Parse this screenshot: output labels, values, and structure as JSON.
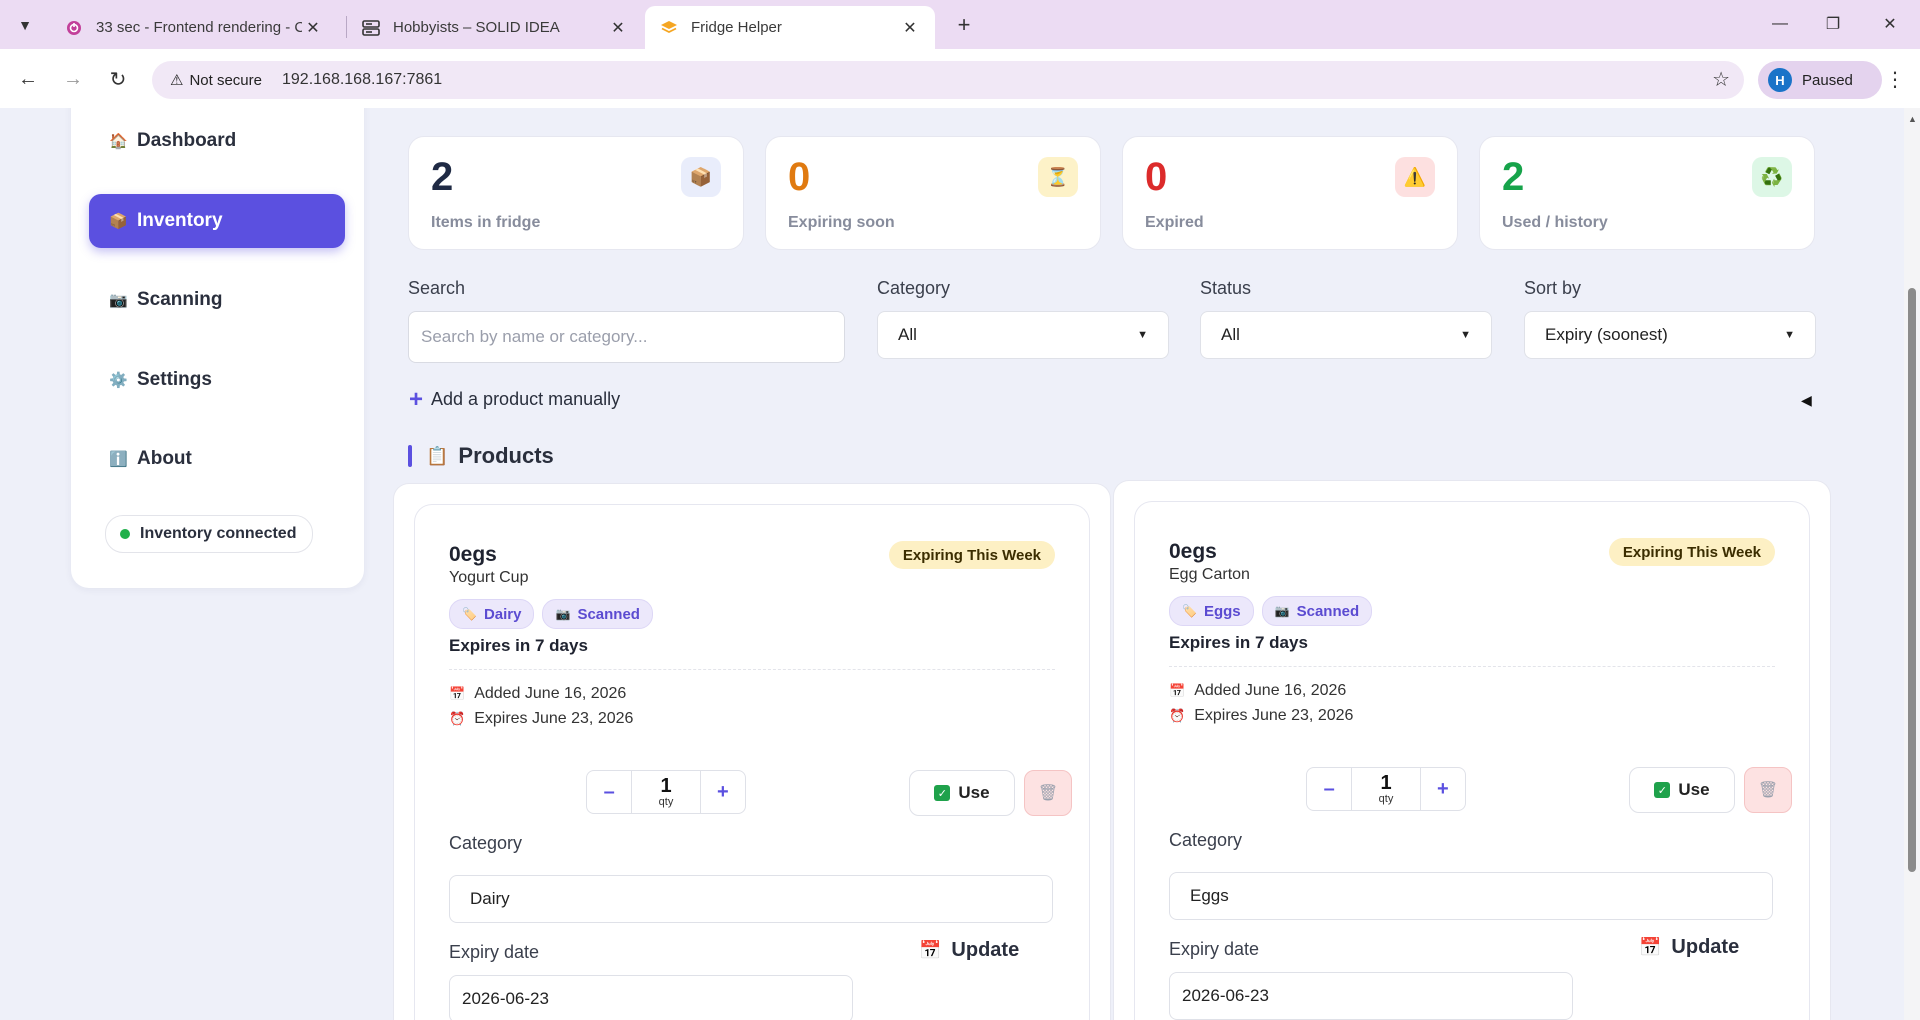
{
  "browser": {
    "tabs": [
      {
        "title": "33 sec - Frontend rendering - C",
        "icon": "timer-icon"
      },
      {
        "title": "Hobbyists – SOLID IDEA",
        "icon": "server-icon"
      },
      {
        "title": "Fridge Helper",
        "icon": "layers-icon"
      }
    ],
    "security_label": "Not secure",
    "url": "192.168.168.167:7861",
    "profile_initial": "H",
    "profile_status": "Paused"
  },
  "sidebar": {
    "items": [
      {
        "label": "Dashboard",
        "icon": "🏠"
      },
      {
        "label": "Inventory",
        "icon": "📦"
      },
      {
        "label": "Scanning",
        "icon": "📷"
      },
      {
        "label": "Settings",
        "icon": "⚙️"
      },
      {
        "label": "About",
        "icon": "ℹ️"
      }
    ],
    "status": "Inventory connected"
  },
  "stats": [
    {
      "value": "2",
      "label": "Items in fridge",
      "icon": "📦",
      "color": "#1f2a44",
      "badge_bg": "#e9edfb"
    },
    {
      "value": "0",
      "label": "Expiring soon",
      "icon": "⏳",
      "color": "#e07a10",
      "badge_bg": "#fdf2c8"
    },
    {
      "value": "0",
      "label": "Expired",
      "icon": "⚠️",
      "color": "#dc2b2b",
      "badge_bg": "#fde0e0"
    },
    {
      "value": "2",
      "label": "Used / history",
      "icon": "♻️",
      "color": "#16a34a",
      "badge_bg": "#ddf7e6"
    }
  ],
  "filters": {
    "search_label": "Search",
    "search_placeholder": "Search by name or category...",
    "category_label": "Category",
    "category_value": "All",
    "status_label": "Status",
    "status_value": "All",
    "sort_label": "Sort by",
    "sort_value": "Expiry (soonest)"
  },
  "add_manual": "Add a product manually",
  "products_title": "Products",
  "products_icon": "📋",
  "products": [
    {
      "name": "0egs",
      "subtitle": "Yogurt Cup",
      "status": "Expiring This Week",
      "tags": [
        {
          "label": "Dairy",
          "icon": "🏷️"
        },
        {
          "label": "Scanned",
          "icon": "📷"
        }
      ],
      "expires_text": "Expires in 7 days",
      "added": "Added June 16, 2026",
      "expires_on": "Expires June 23, 2026",
      "qty": "1",
      "qty_unit": "qty",
      "use_label": "Use",
      "category_label": "Category",
      "category_value": "Dairy",
      "expiry_label": "Expiry date",
      "expiry_value": "2026-06-23",
      "update_label": "Update"
    },
    {
      "name": "0egs",
      "subtitle": "Egg Carton",
      "status": "Expiring This Week",
      "tags": [
        {
          "label": "Eggs",
          "icon": "🏷️"
        },
        {
          "label": "Scanned",
          "icon": "📷"
        }
      ],
      "expires_text": "Expires in 7 days",
      "added": "Added June 16, 2026",
      "expires_on": "Expires June 23, 2026",
      "qty": "1",
      "qty_unit": "qty",
      "use_label": "Use",
      "category_label": "Category",
      "category_value": "Eggs",
      "expiry_label": "Expiry date",
      "expiry_value": "2026-06-23",
      "update_label": "Update"
    }
  ],
  "colors": {
    "accent": "#5b50e0",
    "status_badge_bg": "#fdf0c4"
  }
}
